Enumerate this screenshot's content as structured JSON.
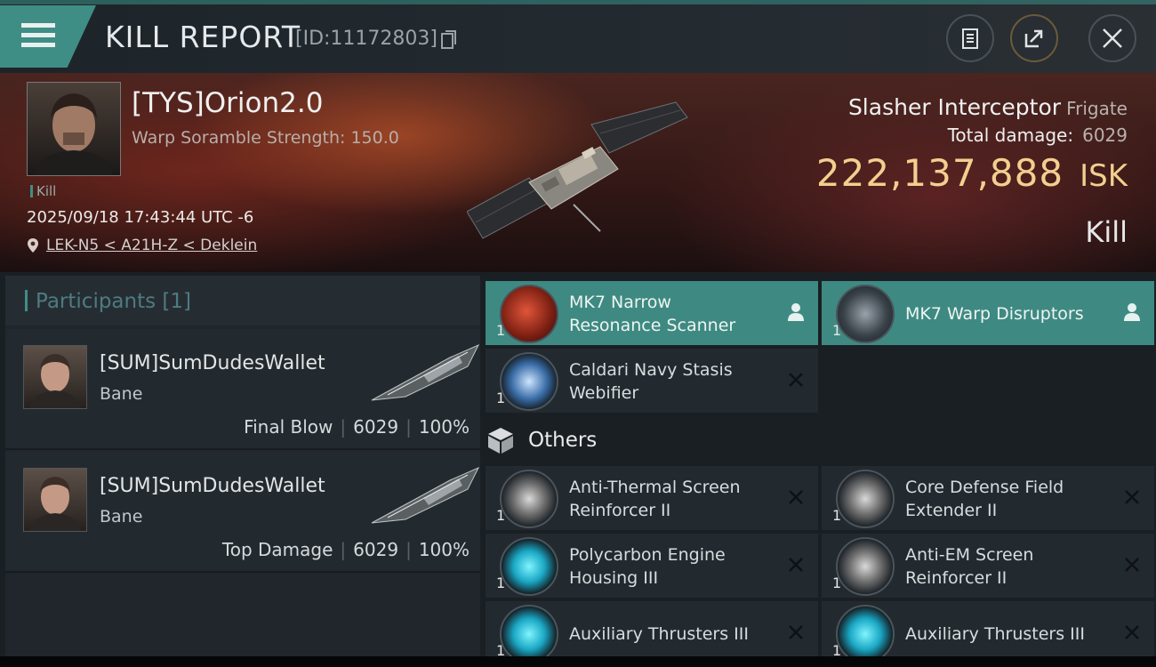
{
  "header": {
    "title": "KILL REPORT",
    "report_id": "[ID:11172803]"
  },
  "victim": {
    "name": "[TYS]Orion2.0",
    "warp_scramble": "Warp Soramble Strength: 150.0",
    "kill_tag": "Kill",
    "datetime": "2025/09/18 17:43:44 UTC -6",
    "location": "LEK-N5 < A21H-Z < Deklein",
    "ship_name": "Slasher Interceptor",
    "ship_class": "Frigate",
    "total_damage_label": "Total damage:",
    "total_damage": "6029",
    "isk_value": "222,137,888",
    "isk_unit": "ISK",
    "outcome": "Kill"
  },
  "participants": {
    "title": "Participants",
    "count": "[1]",
    "items": [
      {
        "name": "[SUM]SumDudesWallet",
        "ship": "Bane",
        "role": "Final Blow",
        "damage": "6029",
        "percent": "100%"
      },
      {
        "name": "[SUM]SumDudesWallet",
        "ship": "Bane",
        "role": "Top Damage",
        "damage": "6029",
        "percent": "100%"
      }
    ]
  },
  "modules": {
    "high": [
      {
        "qty": "1",
        "line1": "MK7 Narrow",
        "line2": "Resonance Scanner",
        "action": "pilot-icon"
      },
      {
        "qty": "1",
        "line1": "MK7 Warp Disruptors",
        "line2": "",
        "action": "pilot-icon"
      },
      {
        "qty": "1",
        "line1": "Caldari Navy Stasis",
        "line2": "Webifier",
        "action": "close-icon"
      }
    ],
    "others_label": "Others",
    "others": [
      {
        "qty": "1",
        "line1": "Anti-Thermal Screen",
        "line2": "Reinforcer II"
      },
      {
        "qty": "1",
        "line1": "Core Defense Field",
        "line2": "Extender II"
      },
      {
        "qty": "1",
        "line1": "Polycarbon Engine",
        "line2": "Housing III"
      },
      {
        "qty": "1",
        "line1": "Anti-EM Screen",
        "line2": "Reinforcer II"
      },
      {
        "qty": "1",
        "line1": "Auxiliary Thrusters III",
        "line2": ""
      },
      {
        "qty": "1",
        "line1": "Auxiliary Thrusters III",
        "line2": ""
      }
    ]
  },
  "colors": {
    "accent": "#3f8e86",
    "isk": "#f3cf8f",
    "panel": "#232a2f"
  }
}
